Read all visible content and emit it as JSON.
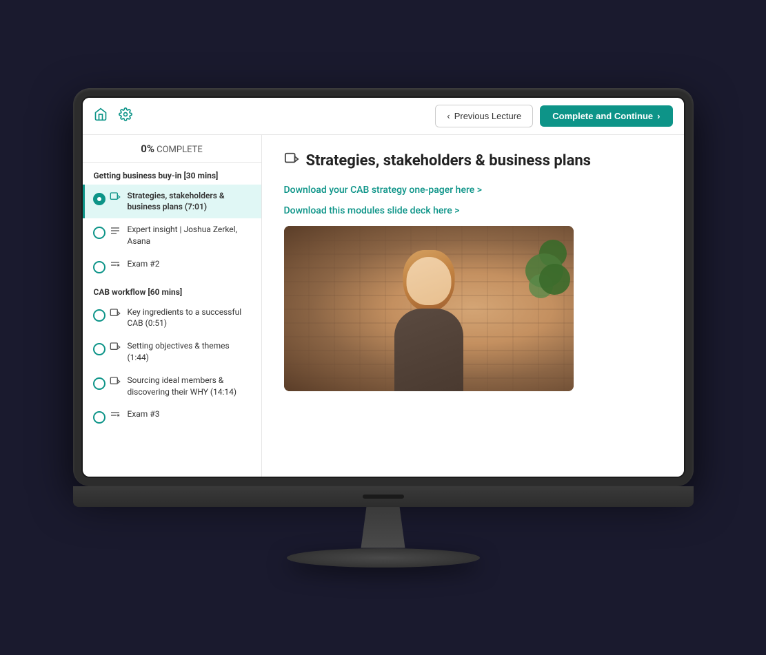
{
  "topbar": {
    "prev_btn": "Previous Lecture",
    "complete_btn": "Complete and Continue",
    "home_icon": "home",
    "gear_icon": "settings"
  },
  "sidebar": {
    "progress_percent": "0%",
    "progress_label": "COMPLETE",
    "sections": [
      {
        "title": "Getting business buy-in [30 mins]",
        "lessons": [
          {
            "id": "lesson-1",
            "title": "Strategies, stakeholders & business plans (7:01)",
            "type": "video",
            "active": true
          },
          {
            "id": "lesson-2",
            "title": "Expert insight | Joshua Zerkel, Asana",
            "type": "text",
            "active": false
          },
          {
            "id": "lesson-3",
            "title": "Exam #2",
            "type": "quiz",
            "active": false
          }
        ]
      },
      {
        "title": "CAB workflow [60 mins]",
        "lessons": [
          {
            "id": "lesson-4",
            "title": "Key ingredients to a successful CAB (0:51)",
            "type": "video",
            "active": false
          },
          {
            "id": "lesson-5",
            "title": "Setting objectives & themes (1:44)",
            "type": "video",
            "active": false
          },
          {
            "id": "lesson-6",
            "title": "Sourcing ideal members & discovering their WHY (14:14)",
            "type": "video",
            "active": false
          },
          {
            "id": "lesson-7",
            "title": "Exam #3",
            "type": "quiz",
            "active": false
          }
        ]
      }
    ]
  },
  "content": {
    "lecture_title": "Strategies, stakeholders & business plans",
    "download_link_1": "Download your CAB strategy one-pager here >",
    "download_link_2": "Download this modules slide deck here >"
  }
}
